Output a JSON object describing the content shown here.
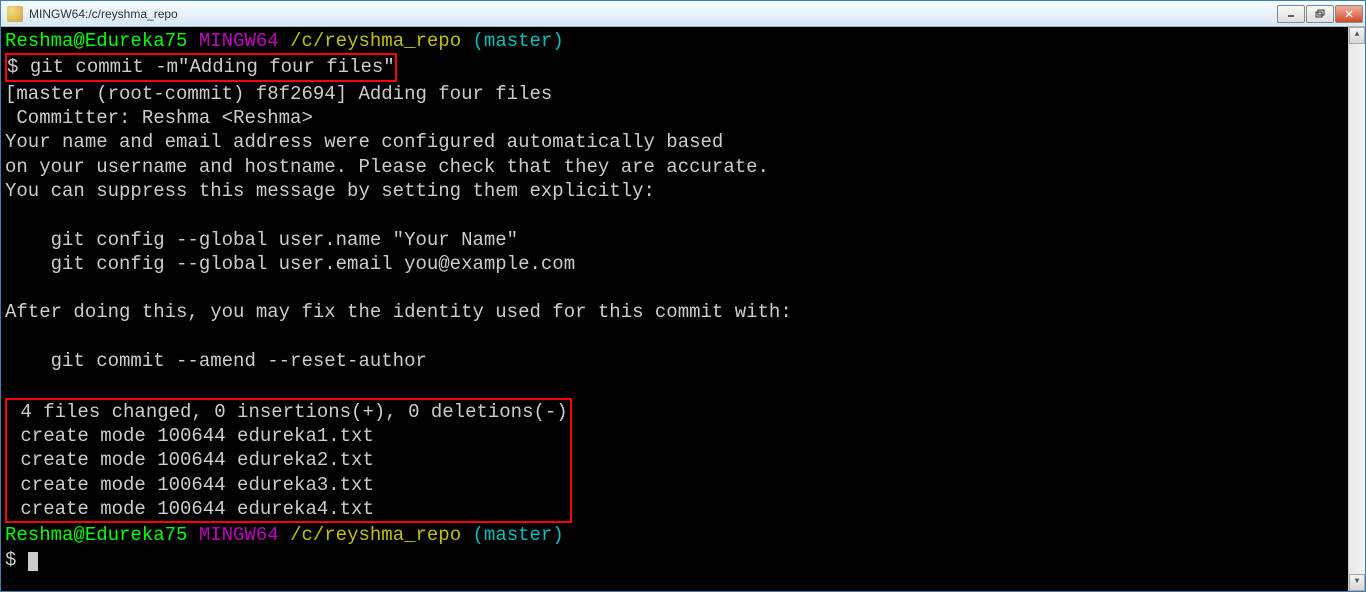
{
  "titlebar": {
    "title": "MINGW64:/c/reyshma_repo"
  },
  "prompt1": {
    "user_host": "Reshma@Edureka75",
    "env": "MINGW64",
    "path": "/c/reyshma_repo",
    "branch": "(master)"
  },
  "command1": {
    "prefix": "$ ",
    "cmd": "git commit -m\"Adding four files\""
  },
  "output": {
    "line1": "[master (root-commit) f8f2694] Adding four files",
    "line2": " Committer: Reshma <Reshma>",
    "line3": "Your name and email address were configured automatically based",
    "line4": "on your username and hostname. Please check that they are accurate.",
    "line5": "You can suppress this message by setting them explicitly:",
    "line6": "    git config --global user.name \"Your Name\"",
    "line7": "    git config --global user.email you@example.com",
    "line8": "After doing this, you may fix the identity used for this commit with:",
    "line9": "    git commit --amend --reset-author"
  },
  "summary": {
    "line1": " 4 files changed, 0 insertions(+), 0 deletions(-)",
    "line2": " create mode 100644 edureka1.txt",
    "line3": " create mode 100644 edureka2.txt",
    "line4": " create mode 100644 edureka3.txt",
    "line5": " create mode 100644 edureka4.txt"
  },
  "prompt2": {
    "user_host": "Reshma@Edureka75",
    "env": "MINGW64",
    "path": "/c/reyshma_repo",
    "branch": "(master)",
    "dollar": "$"
  }
}
